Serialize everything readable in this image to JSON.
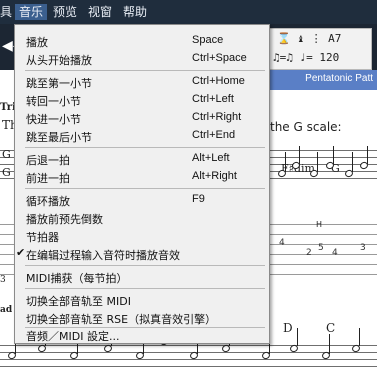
{
  "menubar": {
    "items": [
      "具",
      "音乐",
      "预览",
      "视窗",
      "帮助"
    ]
  },
  "toolbar": {
    "lcd_row1": "⌛ ♝ ⋮ A7",
    "lcd_row2": "♫=♫ ♩= 120",
    "section_label": "Pentatonic Patt"
  },
  "score": {
    "lines_text": {
      "tri": "Tri",
      "g_scale": "the G scale:",
      "chord_fdim": "F♯dim",
      "chord_g": "G",
      "left_g1": "G",
      "left_g2": "G",
      "th": "Th",
      "chord_d": "D",
      "chord_c": "C",
      "ad": "ad",
      "tab_left": "3",
      "h_mark": "H"
    },
    "tab_numbers": [
      "4",
      "2",
      "5",
      "4",
      "3"
    ]
  },
  "menu": {
    "items": [
      {
        "label": "播放",
        "shortcut": "Space"
      },
      {
        "label": "从头开始播放",
        "shortcut": "Ctrl+Space"
      },
      {
        "label": "跳至第一小节",
        "shortcut": "Ctrl+Home"
      },
      {
        "label": "转回一小节",
        "shortcut": "Ctrl+Left"
      },
      {
        "label": "快进一小节",
        "shortcut": "Ctrl+Right"
      },
      {
        "label": "跳至最后小节",
        "shortcut": "Ctrl+End"
      },
      {
        "label": "后退一拍",
        "shortcut": "Alt+Left"
      },
      {
        "label": "前进一拍",
        "shortcut": "Alt+Right"
      },
      {
        "label": "循环播放",
        "shortcut": "F9"
      },
      {
        "label": "播放前预先倒数",
        "shortcut": ""
      },
      {
        "label": "节拍器",
        "shortcut": ""
      },
      {
        "label": "在编辑过程输入音符时播放音效",
        "shortcut": "",
        "checked": true
      },
      {
        "label": "MIDI捕获（每节拍）",
        "shortcut": ""
      },
      {
        "label": "切换全部音轨至 MIDI",
        "shortcut": ""
      },
      {
        "label": "切换全部音轨至 RSE（拟真音效引擎）",
        "shortcut": ""
      },
      {
        "label": "音频／MIDI 設定...",
        "shortcut": ""
      }
    ],
    "check_mark": "✔"
  },
  "colors": {
    "menubar_bg": "#1f2d3d",
    "menu_active_bg": "#3b5f8e",
    "menu_bg": "#f0f0f0",
    "section_bar": "#5a7fc6"
  }
}
